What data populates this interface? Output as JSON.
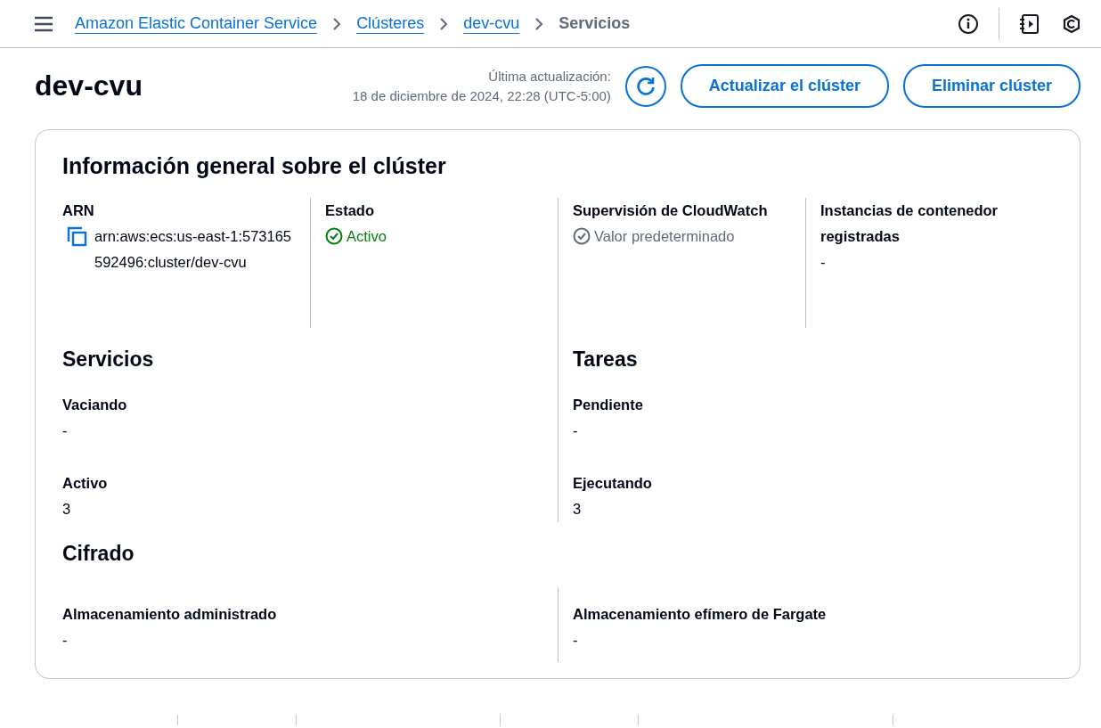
{
  "header": {
    "breadcrumbs": [
      {
        "label": "Amazon Elastic Container Service",
        "link": true
      },
      {
        "label": "Clústeres",
        "link": true
      },
      {
        "label": "dev-cvu",
        "link": true
      },
      {
        "label": "Servicios",
        "link": false
      }
    ]
  },
  "page": {
    "title": "dev-cvu",
    "updated_label": "Última actualización:",
    "updated_value": "18 de diciembre de 2024, 22:28 (UTC-5:00)",
    "buttons": [
      "Actualizar el clúster",
      "Eliminar clúster"
    ]
  },
  "card": {
    "title": "Información general sobre el clúster",
    "overview": [
      {
        "label": "ARN",
        "value": "arn:aws:ecs:us-east-1:573165592496:cluster/dev-cvu",
        "kind": "copy"
      },
      {
        "label": "Estado",
        "value": "Activo",
        "kind": "status",
        "color": "#037f0c"
      },
      {
        "label": "Supervisión de CloudWatch",
        "value": "Valor predeterminado",
        "kind": "status",
        "color": "#5f6b7a"
      },
      {
        "label": "Instancias de contenedor registradas",
        "value": "-",
        "kind": "text"
      }
    ],
    "groups": [
      {
        "heading": "Servicios",
        "fields": [
          {
            "label": "Vaciando",
            "value": "-"
          },
          {
            "label": "Activo",
            "value": "3"
          }
        ]
      },
      {
        "heading": "Tareas",
        "fields": [
          {
            "label": "Pendiente",
            "value": "-"
          },
          {
            "label": "Ejecutando",
            "value": "3"
          }
        ]
      }
    ],
    "encryption": {
      "heading": "Cifrado",
      "fields": [
        {
          "label": "Almacenamiento administrado",
          "value": "-"
        },
        {
          "label": "Almacenamiento efímero de Fargate",
          "value": "-"
        }
      ]
    }
  }
}
